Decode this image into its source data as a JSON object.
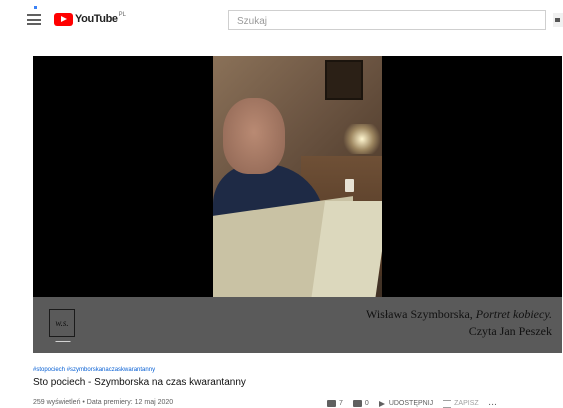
{
  "header": {
    "logo_text": "YouTube",
    "logo_country": "PL",
    "search": {
      "placeholder": "Szukaj",
      "value": ""
    }
  },
  "video": {
    "overlay": {
      "logo_letters": "w.s.",
      "caption_author": "Wisława Szymborska, ",
      "caption_title": "Portret kobiecy.",
      "caption_reader": "Czyta Jan Peszek"
    }
  },
  "info": {
    "hashtags": "#stopociech #szymborskanaczaskwarantanny",
    "title": "Sto pociech - Szymborska na czas kwarantanny",
    "meta": "259 wyświetleń • Data premiery: 12 maj 2020"
  },
  "actions": {
    "like_count": "7",
    "dislike_count": "0",
    "share_label": "UDOSTĘPNIJ",
    "save_label": "ZAPISZ",
    "more_label": "..."
  },
  "colors": {
    "brand_red": "#ff0000",
    "link_blue": "#065fd4",
    "lower_third": "#5a5a5a"
  },
  "icons": [
    "menu-icon",
    "youtube-logo-icon",
    "search-icon",
    "like-icon",
    "dislike-icon",
    "share-icon",
    "save-icon",
    "more-icon"
  ]
}
